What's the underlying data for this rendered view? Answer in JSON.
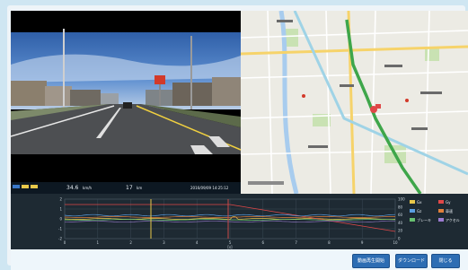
{
  "video_panel": {
    "speed_value": "34.6",
    "speed_unit": "km/h",
    "distance_value": "17",
    "distance_unit": "km",
    "timestamp": "2016/09/09 14:25:12"
  },
  "chart_data": {
    "type": "line",
    "x_ticks": [
      "0",
      "1",
      "2",
      "3",
      "4",
      "5",
      "6",
      "7",
      "8",
      "9",
      "10"
    ],
    "xlabel": "[s]",
    "y_left_ticks": [
      "2",
      "1",
      "0",
      "-1",
      "-2"
    ],
    "y_right_ticks": [
      "100",
      "80",
      "60",
      "40",
      "20",
      "0"
    ],
    "legend": [
      {
        "name": "Gx",
        "color": "#e8c84a"
      },
      {
        "name": "Gy",
        "color": "#e04848"
      },
      {
        "name": "Gz",
        "color": "#5a9ee0"
      },
      {
        "name": "車速",
        "color": "#e07f3a"
      },
      {
        "name": "ブレーキ",
        "color": "#68c070"
      },
      {
        "name": "アクセル",
        "color": "#9b7bd0"
      }
    ]
  },
  "footer": {
    "buttons": [
      "動画再生開始",
      "ダウンロード",
      "閉じる"
    ]
  }
}
